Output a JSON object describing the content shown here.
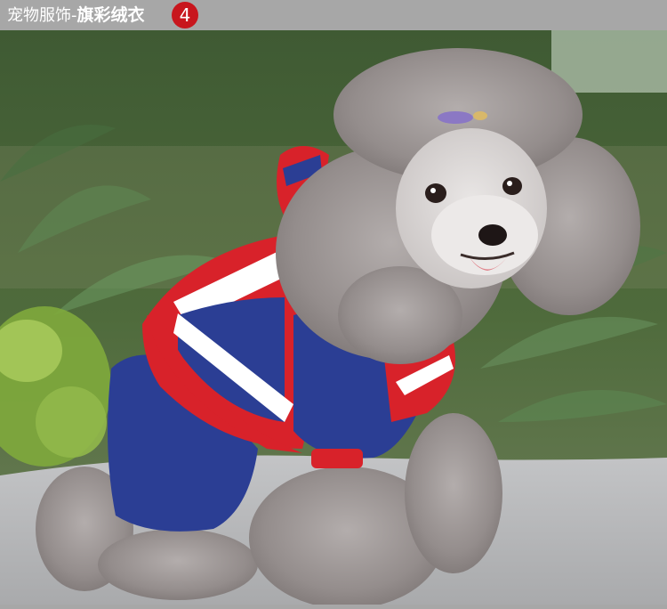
{
  "header": {
    "title_prefix": "宠物服饰-",
    "title_main": "旗彩绒衣",
    "badge_number": "4",
    "background_color": "#a7a7a7",
    "badge_color": "#c8161d"
  },
  "photo": {
    "subject": "grey-poodle-in-union-jack-fleece-jumpsuit",
    "colors": {
      "blue": "#2b3e94",
      "red": "#d8222a",
      "fur": "#9b9595",
      "ground": "#bcbcbc"
    }
  }
}
